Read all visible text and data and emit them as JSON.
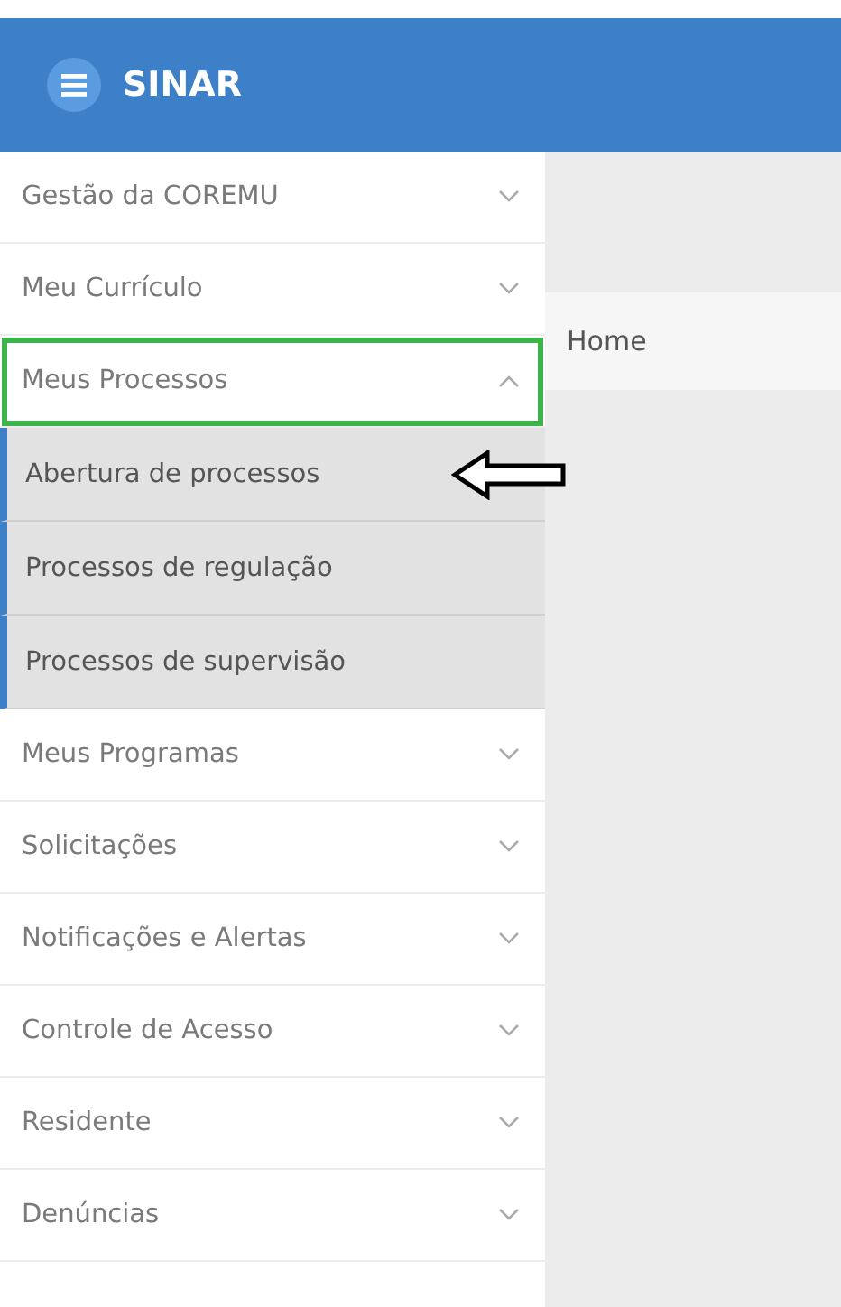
{
  "header": {
    "title": "SINAR"
  },
  "sidebar": {
    "items": [
      {
        "label": "Gestão da COREMU",
        "expanded": false,
        "highlighted": false
      },
      {
        "label": "Meu Currículo",
        "expanded": false,
        "highlighted": false
      },
      {
        "label": "Meus Processos",
        "expanded": true,
        "highlighted": true,
        "children": [
          {
            "label": "Abertura de processos",
            "pointed": true
          },
          {
            "label": "Processos de regulação",
            "pointed": false
          },
          {
            "label": "Processos de supervisão",
            "pointed": false
          }
        ]
      },
      {
        "label": "Meus Programas",
        "expanded": false,
        "highlighted": false
      },
      {
        "label": "Solicitações",
        "expanded": false,
        "highlighted": false
      },
      {
        "label": "Notificações e Alertas",
        "expanded": false,
        "highlighted": false
      },
      {
        "label": "Controle de Acesso",
        "expanded": false,
        "highlighted": false
      },
      {
        "label": "Residente",
        "expanded": false,
        "highlighted": false
      },
      {
        "label": "Denúncias",
        "expanded": false,
        "highlighted": false
      }
    ]
  },
  "breadcrumb": {
    "label": "Home"
  }
}
